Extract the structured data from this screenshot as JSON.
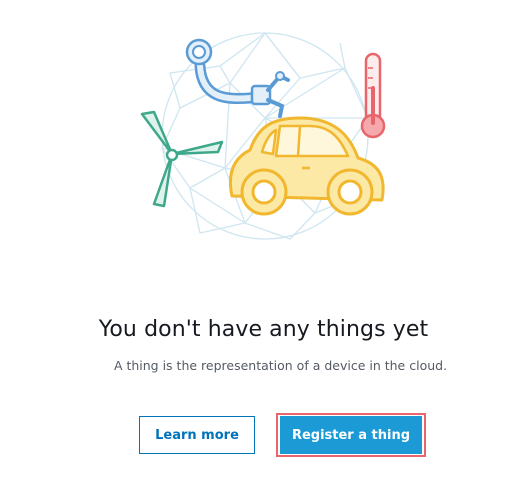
{
  "empty_state": {
    "title": "You don't have any things yet",
    "subtitle": "A thing is the representation of a device in the cloud."
  },
  "actions": {
    "learn_more_label": "Learn more",
    "register_label": "Register a thing"
  },
  "icons": [
    "robot-arm-icon",
    "wind-turbine-icon",
    "thermometer-icon",
    "car-icon",
    "geodesic-sphere-icon"
  ],
  "colors": {
    "primary": "#1b9ad6",
    "link": "#0073bb",
    "highlight": "#e8656c",
    "car": "#f7c948",
    "turbine": "#3fa88a",
    "robot_arm": "#5b9bd5",
    "thermometer": "#e8656c"
  }
}
